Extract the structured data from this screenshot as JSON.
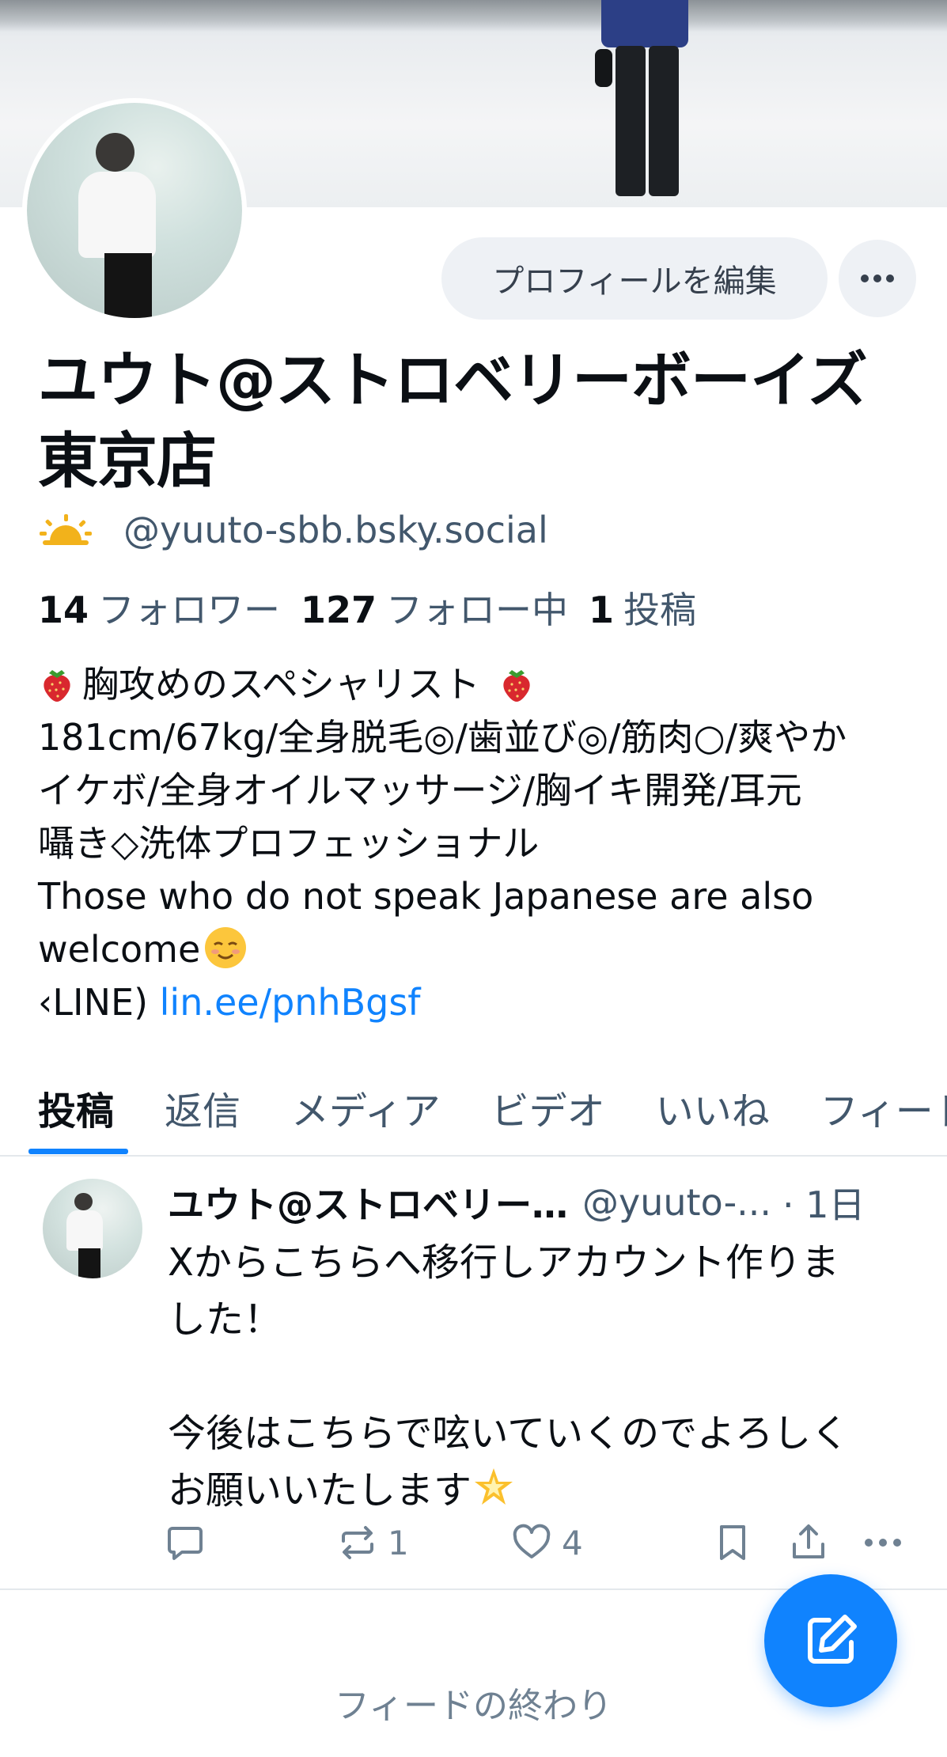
{
  "profile": {
    "display_name": "ユウト@ストロベリーボーイズ東京店",
    "handle_icon": "sun-emoji",
    "handle": "@yuuto-sbb.bsky.social",
    "edit_button_label": "プロフィールを編集",
    "stats": {
      "followers_count": "14",
      "followers_label": "フォロワー",
      "following_count": "127",
      "following_label": "フォロー中",
      "posts_count": "1",
      "posts_label": "投稿"
    },
    "bio": {
      "line1": "胸攻めのスペシャリスト",
      "line2": "181cm/67kg/全身脱毛◎/歯並び◎/筋肉○/爽やか",
      "line3": "イケボ/全身オイルマッサージ/胸イキ開発/耳元",
      "line4": "囁き◇洗体プロフェッショナル",
      "line5": "Those who do not speak Japanese are also",
      "line6": "welcome",
      "line7_prefix": "‹LINE)",
      "line7_link": "lin.ee/pnhBgsf"
    }
  },
  "tabs": [
    "投稿",
    "返信",
    "メディア",
    "ビデオ",
    "いいね",
    "フィード"
  ],
  "active_tab": "投稿",
  "post": {
    "author": "ユウト@ストロベリー…",
    "handle": "@yuuto-...",
    "time": "· 1日",
    "text_line1": "Xからこちらへ移行しアカウント作りま",
    "text_line2": "した！",
    "text_line3": "",
    "text_line4": "今後はこちらで呟いていくのでよろしく",
    "text_line5": "お願いいたします",
    "repost_count": "1",
    "like_count": "4"
  },
  "feed_end_label": "フィードの終わり",
  "colors": {
    "accent": "#1083fe",
    "text_primary": "#0b0f14",
    "text_secondary": "#42576c",
    "button_bg": "#eef1f5"
  }
}
